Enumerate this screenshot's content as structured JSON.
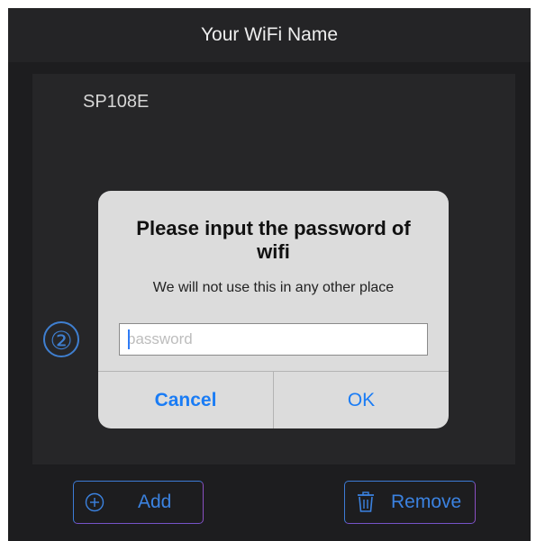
{
  "nav": {
    "title": "Your WiFi Name"
  },
  "panel": {
    "wifi_name": "SP108E",
    "step_badge": "②"
  },
  "alert": {
    "title": "Please input the password of wifi",
    "message": "We will not use this in any other place",
    "input_value": "",
    "input_placeholder": "password",
    "cancel_label": "Cancel",
    "ok_label": "OK"
  },
  "bottom_bar": {
    "add_label": "Add",
    "add_icon": "plus-circle-icon",
    "remove_label": "Remove",
    "remove_icon": "trash-icon"
  },
  "colors": {
    "accent": "#1a7cf5",
    "background": "#1d1d1f",
    "alert_background": "#dcdcdc"
  }
}
